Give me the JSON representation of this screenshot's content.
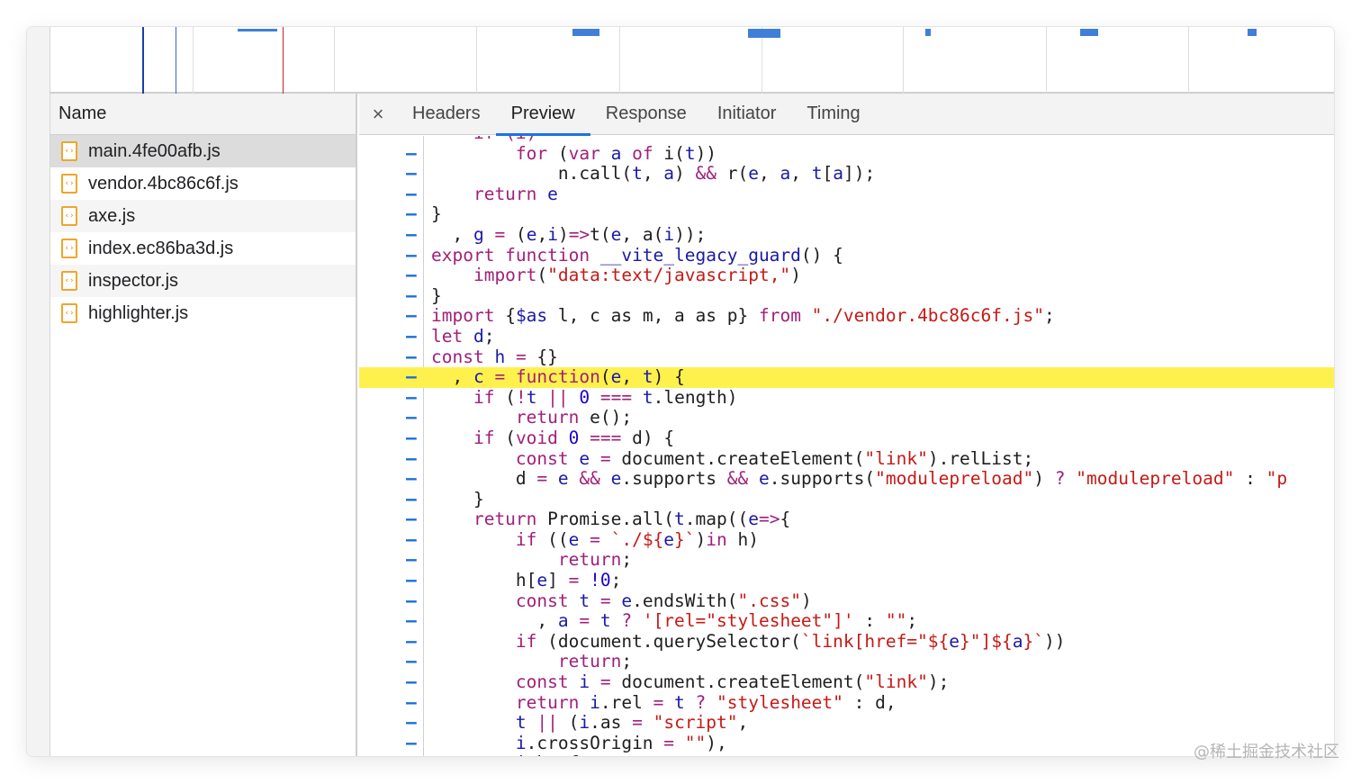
{
  "name_column": {
    "header": "Name",
    "files": [
      {
        "name": "main.4fe00afb.js",
        "icon": "js-file-icon"
      },
      {
        "name": "vendor.4bc86c6f.js",
        "icon": "js-file-icon"
      },
      {
        "name": "axe.js",
        "icon": "js-file-icon"
      },
      {
        "name": "index.ec86ba3d.js",
        "icon": "js-file-icon"
      },
      {
        "name": "inspector.js",
        "icon": "js-file-icon"
      },
      {
        "name": "highlighter.js",
        "icon": "js-file-icon"
      }
    ],
    "selected_index": 0
  },
  "detail": {
    "close_label": "×",
    "tabs": [
      "Headers",
      "Preview",
      "Response",
      "Initiator",
      "Timing"
    ],
    "active_tab": "Preview"
  },
  "code": {
    "line_marker": "–",
    "highlighted_line": 12,
    "lines": [
      [
        [
          "kw",
          "    if (i)"
        ]
      ],
      [
        [
          "kw",
          "        for "
        ],
        [
          "pl",
          "("
        ],
        [
          "kw",
          "var "
        ],
        [
          "vr",
          "a "
        ],
        [
          "kw",
          "of "
        ],
        [
          "pl",
          "i("
        ],
        [
          "vr",
          "t"
        ],
        [
          "pl",
          "))"
        ]
      ],
      [
        [
          "pl",
          "            n.call("
        ],
        [
          "vr",
          "t"
        ],
        [
          "pl",
          ", "
        ],
        [
          "vr",
          "a"
        ],
        [
          "pl",
          ") "
        ],
        [
          "kw",
          "&& "
        ],
        [
          "pl",
          "r("
        ],
        [
          "vr",
          "e"
        ],
        [
          "pl",
          ", "
        ],
        [
          "vr",
          "a"
        ],
        [
          "pl",
          ", "
        ],
        [
          "vr",
          "t"
        ],
        [
          "pl",
          "["
        ],
        [
          "vr",
          "a"
        ],
        [
          "pl",
          "]);"
        ]
      ],
      [
        [
          "kw",
          "    return "
        ],
        [
          "vr",
          "e"
        ]
      ],
      [
        [
          "pl",
          "}"
        ]
      ],
      [
        [
          "pl",
          "  , "
        ],
        [
          "vr",
          "g "
        ],
        [
          "kw",
          "= "
        ],
        [
          "pl",
          "("
        ],
        [
          "vr",
          "e"
        ],
        [
          "pl",
          ","
        ],
        [
          "vr",
          "i"
        ],
        [
          "pl",
          ")"
        ],
        [
          "kw",
          "=>"
        ],
        [
          "pl",
          "t("
        ],
        [
          "vr",
          "e"
        ],
        [
          "pl",
          ", a("
        ],
        [
          "vr",
          "i"
        ],
        [
          "pl",
          "));"
        ]
      ],
      [
        [
          "kw",
          "export function "
        ],
        [
          "vr",
          "__vite_legacy_guard"
        ],
        [
          "pl",
          "() {"
        ]
      ],
      [
        [
          "kw",
          "    import"
        ],
        [
          "pl",
          "("
        ],
        [
          "st",
          "\"data:text/javascript,\""
        ],
        [
          "pl",
          ")"
        ]
      ],
      [
        [
          "pl",
          "}"
        ]
      ],
      [
        [
          "kw",
          "import "
        ],
        [
          "pl",
          "{"
        ],
        [
          "vr",
          "$as "
        ],
        [
          "pl",
          "l, c as m, a as p} "
        ],
        [
          "kw",
          "from "
        ],
        [
          "st",
          "\"./vendor.4bc86c6f.js\""
        ],
        [
          "pl",
          ";"
        ]
      ],
      [
        [
          "kw",
          "let "
        ],
        [
          "vr",
          "d"
        ],
        [
          "pl",
          ";"
        ]
      ],
      [
        [
          "kw",
          "const "
        ],
        [
          "vr",
          "h "
        ],
        [
          "kw",
          "= "
        ],
        [
          "pl",
          "{}"
        ]
      ],
      [
        [
          "pl",
          "  , "
        ],
        [
          "vr",
          "c "
        ],
        [
          "kw",
          "= function"
        ],
        [
          "pl",
          "("
        ],
        [
          "vr",
          "e"
        ],
        [
          "pl",
          ", "
        ],
        [
          "vr",
          "t"
        ],
        [
          "pl",
          ") {"
        ]
      ],
      [
        [
          "kw",
          "    if "
        ],
        [
          "pl",
          "("
        ],
        [
          "kw",
          "!"
        ],
        [
          "vr",
          "t "
        ],
        [
          "kw",
          "|| "
        ],
        [
          "nm",
          "0 "
        ],
        [
          "kw",
          "=== "
        ],
        [
          "vr",
          "t"
        ],
        [
          "pl",
          ".length)"
        ]
      ],
      [
        [
          "kw",
          "        return "
        ],
        [
          "pl",
          "e();"
        ]
      ],
      [
        [
          "kw",
          "    if "
        ],
        [
          "pl",
          "("
        ],
        [
          "kw",
          "void "
        ],
        [
          "nm",
          "0 "
        ],
        [
          "kw",
          "=== "
        ],
        [
          "pl",
          "d) {"
        ]
      ],
      [
        [
          "kw",
          "        const "
        ],
        [
          "vr",
          "e "
        ],
        [
          "kw",
          "= "
        ],
        [
          "pl",
          "document.createElement("
        ],
        [
          "st",
          "\"link\""
        ],
        [
          "pl",
          ").relList;"
        ]
      ],
      [
        [
          "pl",
          "        d "
        ],
        [
          "kw",
          "= "
        ],
        [
          "vr",
          "e "
        ],
        [
          "kw",
          "&& "
        ],
        [
          "vr",
          "e"
        ],
        [
          "pl",
          ".supports "
        ],
        [
          "kw",
          "&& "
        ],
        [
          "vr",
          "e"
        ],
        [
          "pl",
          ".supports("
        ],
        [
          "st",
          "\"modulepreload\""
        ],
        [
          "pl",
          ") "
        ],
        [
          "kw",
          "? "
        ],
        [
          "st",
          "\"modulepreload\""
        ],
        [
          "pl",
          " : "
        ],
        [
          "st",
          "\"p"
        ]
      ],
      [
        [
          "pl",
          "    }"
        ]
      ],
      [
        [
          "kw",
          "    return "
        ],
        [
          "pl",
          "Promise.all("
        ],
        [
          "vr",
          "t"
        ],
        [
          "pl",
          ".map(("
        ],
        [
          "vr",
          "e"
        ],
        [
          "kw",
          "=>"
        ],
        [
          "pl",
          "{"
        ]
      ],
      [
        [
          "kw",
          "        if "
        ],
        [
          "pl",
          "(("
        ],
        [
          "vr",
          "e "
        ],
        [
          "kw",
          "= "
        ],
        [
          "st",
          "`./${"
        ],
        [
          "vr",
          "e"
        ],
        [
          "st",
          "}`"
        ],
        [
          "pl",
          ")"
        ],
        [
          "kw",
          "in "
        ],
        [
          "pl",
          "h)"
        ]
      ],
      [
        [
          "kw",
          "            return"
        ],
        [
          "pl",
          ";"
        ]
      ],
      [
        [
          "pl",
          "        h["
        ],
        [
          "vr",
          "e"
        ],
        [
          "pl",
          "] "
        ],
        [
          "kw",
          "= "
        ],
        [
          "nm",
          "!0"
        ],
        [
          "pl",
          ";"
        ]
      ],
      [
        [
          "kw",
          "        const "
        ],
        [
          "vr",
          "t "
        ],
        [
          "kw",
          "= "
        ],
        [
          "vr",
          "e"
        ],
        [
          "pl",
          ".endsWith("
        ],
        [
          "st",
          "\".css\""
        ],
        [
          "pl",
          ")"
        ]
      ],
      [
        [
          "pl",
          "          , "
        ],
        [
          "vr",
          "a "
        ],
        [
          "kw",
          "= "
        ],
        [
          "vr",
          "t "
        ],
        [
          "kw",
          "? "
        ],
        [
          "st",
          "'[rel=\"stylesheet\"]' "
        ],
        [
          "pl",
          ": "
        ],
        [
          "st",
          "\"\""
        ],
        [
          "pl",
          ";"
        ]
      ],
      [
        [
          "kw",
          "        if "
        ],
        [
          "pl",
          "(document.querySelector("
        ],
        [
          "st",
          "`link[href=\"${"
        ],
        [
          "vr",
          "e"
        ],
        [
          "st",
          "}\"]${"
        ],
        [
          "vr",
          "a"
        ],
        [
          "st",
          "}`"
        ],
        [
          "pl",
          "))"
        ]
      ],
      [
        [
          "kw",
          "            return"
        ],
        [
          "pl",
          ";"
        ]
      ],
      [
        [
          "kw",
          "        const "
        ],
        [
          "vr",
          "i "
        ],
        [
          "kw",
          "= "
        ],
        [
          "pl",
          "document.createElement("
        ],
        [
          "st",
          "\"link\""
        ],
        [
          "pl",
          ");"
        ]
      ],
      [
        [
          "kw",
          "        return "
        ],
        [
          "vr",
          "i"
        ],
        [
          "pl",
          ".rel "
        ],
        [
          "kw",
          "= "
        ],
        [
          "vr",
          "t "
        ],
        [
          "kw",
          "? "
        ],
        [
          "st",
          "\"stylesheet\" "
        ],
        [
          "pl",
          ": d,"
        ]
      ],
      [
        [
          "vr",
          "        t "
        ],
        [
          "kw",
          "|| "
        ],
        [
          "pl",
          "("
        ],
        [
          "vr",
          "i"
        ],
        [
          "pl",
          ".as "
        ],
        [
          "kw",
          "= "
        ],
        [
          "st",
          "\"script\""
        ],
        [
          "pl",
          ","
        ]
      ],
      [
        [
          "vr",
          "        i"
        ],
        [
          "pl",
          ".crossOrigin "
        ],
        [
          "kw",
          "= "
        ],
        [
          "st",
          "\"\""
        ],
        [
          "pl",
          "),"
        ]
      ],
      [
        [
          "vr",
          "        i"
        ],
        [
          "pl",
          ".href = "
        ],
        [
          "vr",
          "e"
        ],
        [
          "pl",
          ","
        ]
      ]
    ]
  },
  "watermark": "@稀土掘金技术社区"
}
